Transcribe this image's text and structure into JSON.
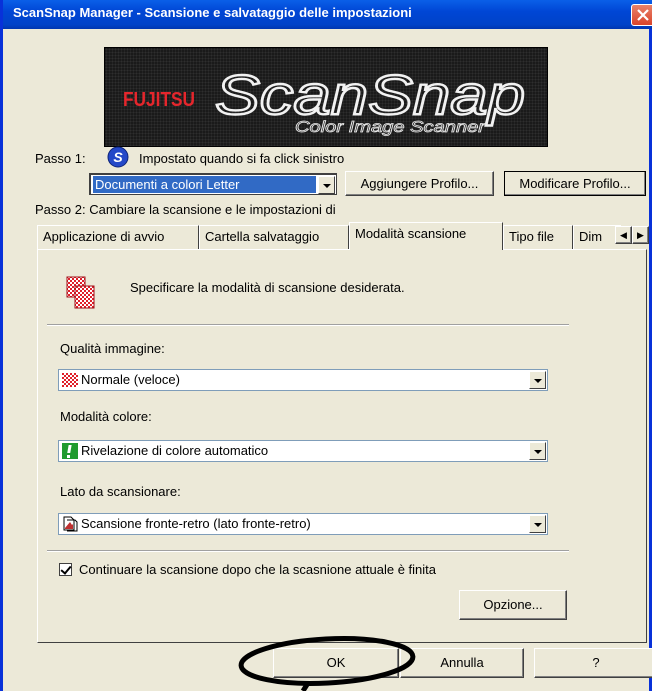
{
  "window": {
    "title": "ScanSnap Manager - Scansione e salvataggio delle impostazioni"
  },
  "logo": {
    "brand": "FUJITSU",
    "product": "ScanSnap",
    "tagline": "Color Image Scanner"
  },
  "step1": {
    "label": "Passo 1:",
    "hint": "Impostato quando si fa click sinistro",
    "profile": "Documenti a colori Letter",
    "add_profile": "Aggiungere Profilo...",
    "edit_profile": "Modificare Profilo..."
  },
  "step2": {
    "label": "Passo 2: Cambiare la scansione e le impostazioni di"
  },
  "tabs": [
    {
      "label": "Applicazione di avvio"
    },
    {
      "label": "Cartella salvataggio"
    },
    {
      "label": "Modalità scansione",
      "active": true
    },
    {
      "label": "Tipo file"
    },
    {
      "label": "Dim"
    }
  ],
  "panel": {
    "description": "Specificare la modalità di scansione desiderata.",
    "image_quality": {
      "label": "Qualità immagine:",
      "value": "Normale (veloce)"
    },
    "color_mode": {
      "label": "Modalità colore:",
      "value": "Rivelazione di colore automatico"
    },
    "scan_side": {
      "label": "Lato da scansionare:",
      "value": "Scansione fronte-retro (lato fronte-retro)"
    },
    "continue_scan": {
      "label": "Continuare la scansione dopo che la scasnione attuale è finita",
      "checked": true
    },
    "option_button": "Opzione..."
  },
  "footer": {
    "ok": "OK",
    "cancel": "Annulla",
    "help": "?"
  },
  "colors": {
    "titlebar": "#0046d5",
    "selection": "#316ac5",
    "dialog_bg": "#ece9d8",
    "annotation": "#000000"
  }
}
